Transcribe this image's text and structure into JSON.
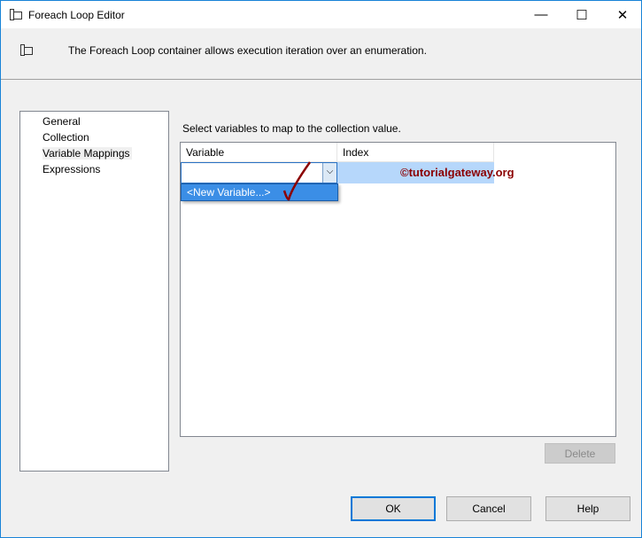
{
  "window": {
    "title": "Foreach Loop Editor",
    "minimize": "—",
    "maximize": "☐",
    "close": "✕"
  },
  "header": {
    "description": "The Foreach Loop container allows execution iteration over an enumeration."
  },
  "nav": {
    "items": [
      {
        "label": "General"
      },
      {
        "label": "Collection"
      },
      {
        "label": "Variable Mappings"
      },
      {
        "label": "Expressions"
      }
    ],
    "selected": "Variable Mappings"
  },
  "main": {
    "instruction": "Select variables to map to the collection value.",
    "columns": [
      "Variable",
      "Index"
    ],
    "variable_value": "",
    "dropdown_options": [
      "<New Variable...>"
    ],
    "watermark": "©tutorialgateway.org"
  },
  "buttons": {
    "delete": "Delete",
    "ok": "OK",
    "cancel": "Cancel",
    "help": "Help"
  }
}
